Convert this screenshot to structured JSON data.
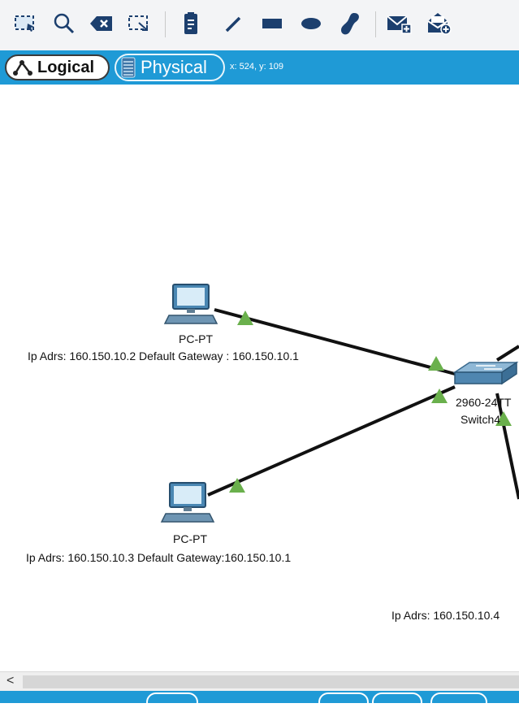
{
  "toolbar": {
    "icons": [
      "select-icon",
      "zoom-icon",
      "delete-icon",
      "resize-icon",
      "note-icon",
      "line-icon",
      "rectangle-icon",
      "ellipse-icon",
      "freeform-icon",
      "add-simple-pdu-icon",
      "add-complex-pdu-icon"
    ]
  },
  "viewbar": {
    "logical_label": "Logical",
    "physical_label": "Physical",
    "coords": "x: 524, y: 109"
  },
  "canvas": {
    "pc1": {
      "type_label": "PC-PT",
      "ip_label": "Ip Adrs: 160.150.10.2 Default Gateway : 160.150.10.1"
    },
    "pc2": {
      "type_label": "PC-PT",
      "ip_label": "Ip Adrs: 160.150.10.3 Default Gateway:160.150.10.1"
    },
    "switch": {
      "model_label": "2960-24TT",
      "name_label": "Switch4"
    },
    "partial_ip_label": "Ip Adrs: 160.150.10.4"
  },
  "scrollbar": {
    "left_arrow": "<"
  },
  "colors": {
    "accent": "#1f9ad6",
    "link": "#111111",
    "link_light": "#6ab04c"
  }
}
